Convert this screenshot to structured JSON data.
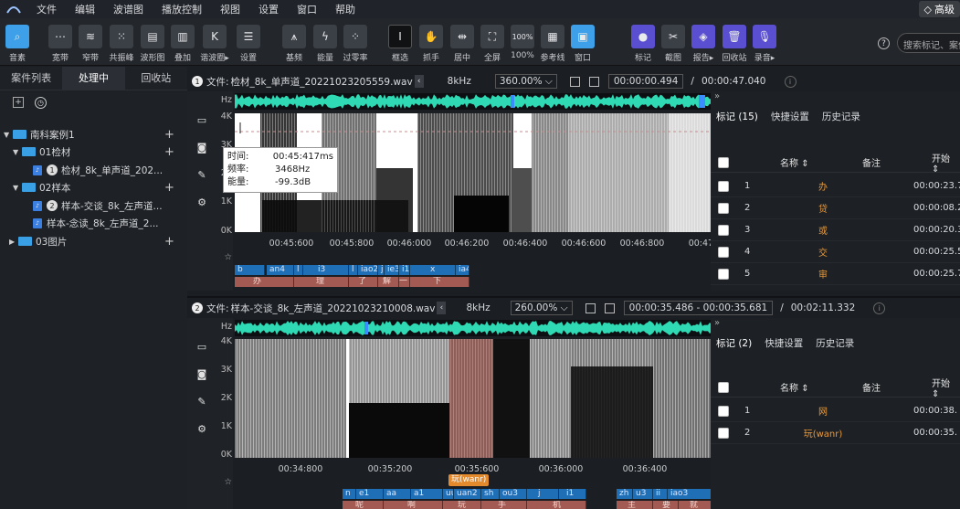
{
  "menubar": {
    "items": [
      "文件",
      "编辑",
      "波谱图",
      "播放控制",
      "视图",
      "设置",
      "窗口",
      "帮助"
    ],
    "premium": "高级"
  },
  "toolbar": {
    "buttons": [
      {
        "label": "音素",
        "icon": "magnifier-icon"
      },
      {
        "label": "宽带",
        "icon": "wideband-icon"
      },
      {
        "label": "窄带",
        "icon": "narrowband-icon"
      },
      {
        "label": "共振峰",
        "icon": "formant-icon"
      },
      {
        "label": "波形图",
        "icon": "waveform-icon"
      },
      {
        "label": "叠加",
        "icon": "overlay-icon"
      },
      {
        "label": "谐波圈▸",
        "icon": "harmonic-icon"
      },
      {
        "label": "设置",
        "icon": "settings-sliders-icon"
      },
      {
        "label": "基频",
        "icon": "pitch-icon"
      },
      {
        "label": "能量",
        "icon": "energy-icon"
      },
      {
        "label": "过零率",
        "icon": "zero-cross-icon"
      },
      {
        "label": "框选",
        "icon": "text-cursor-icon"
      },
      {
        "label": "抓手",
        "icon": "hand-icon"
      },
      {
        "label": "居中",
        "icon": "center-icon"
      },
      {
        "label": "全屏",
        "icon": "fullscreen-icon"
      },
      {
        "label": "100%",
        "icon": "zoom-100-icon",
        "text": "100%"
      },
      {
        "label": "参考线",
        "icon": "grid-icon"
      },
      {
        "label": "窗口",
        "icon": "window-icon"
      },
      {
        "label": "标记",
        "icon": "marker-pin-icon"
      },
      {
        "label": "截图",
        "icon": "scissors-icon"
      },
      {
        "label": "报告▸",
        "icon": "layers-icon"
      },
      {
        "label": "回收站",
        "icon": "trash-icon"
      },
      {
        "label": "录音▸",
        "icon": "microphone-icon"
      }
    ],
    "search_placeholder": "搜索标记、案件"
  },
  "left_panel": {
    "tabs": [
      "案件列表",
      "处理中",
      "回收站"
    ],
    "active_tab": 1,
    "tree": [
      {
        "label": "南科案例1",
        "level": 0,
        "type": "folder",
        "expanded": true
      },
      {
        "label": "01检材",
        "level": 1,
        "type": "folder",
        "expanded": true
      },
      {
        "label": "检材_8k_单声道_202...",
        "level": 2,
        "type": "file",
        "badge": "1"
      },
      {
        "label": "02样本",
        "level": 1,
        "type": "folder",
        "expanded": true
      },
      {
        "label": "样本-交谈_8k_左声道...",
        "level": 2,
        "type": "file",
        "badge": "2"
      },
      {
        "label": "样本-念读_8k_左声道_2...",
        "level": 2,
        "type": "file",
        "badge": ""
      },
      {
        "label": "03图片",
        "level": 1,
        "type": "folder",
        "expanded": false
      }
    ]
  },
  "panel1": {
    "badge": "1",
    "file_label": "文件:",
    "file_name": "检材_8k_单声道_20221023205559.wav",
    "sample_rate": "8kHz",
    "zoom": "360.00%",
    "time_current": "00:00:00.494",
    "time_sep": "/",
    "time_total": "00:00:47.040",
    "y_ticks": [
      "Hz",
      "4K",
      "3K",
      "2K",
      "1K",
      "0K"
    ],
    "x_ticks": [
      "00:45:600",
      "00:45:800",
      "00:46:000",
      "00:46:200",
      "00:46:400",
      "00:46:600",
      "00:46:800",
      "00:47:0"
    ],
    "phonemes": [
      "b",
      "an4",
      "l",
      "i3",
      "l",
      "iao2",
      "j",
      "ie3",
      "i1",
      "x",
      "ia4"
    ],
    "chars": [
      "办",
      "理",
      "了",
      "解",
      "一",
      "下"
    ],
    "tooltip": {
      "time_k": "时间:",
      "time_v": "00:45:417ms",
      "freq_k": "频率:",
      "freq_v": "3468Hz",
      "energy_k": "能量:",
      "energy_v": "-99.3dB"
    },
    "right": {
      "tabs": [
        "标记 (15)",
        "快捷设置",
        "历史记录"
      ],
      "headers": {
        "name": "名称",
        "note": "备注",
        "start": "开始"
      },
      "rows": [
        {
          "idx": "1",
          "name": "办",
          "start": "00:00:23.7"
        },
        {
          "idx": "2",
          "name": "贷",
          "start": "00:00:08.2"
        },
        {
          "idx": "3",
          "name": "或",
          "start": "00:00:20.3"
        },
        {
          "idx": "4",
          "name": "交",
          "start": "00:00:25.5"
        },
        {
          "idx": "5",
          "name": "审",
          "start": "00:00:25.7"
        }
      ]
    }
  },
  "panel2": {
    "badge": "2",
    "file_label": "文件:",
    "file_name": "样本-交谈_8k_左声道_20221023210008.wav",
    "sample_rate": "8kHz",
    "zoom": "260.00%",
    "time_current": "00:00:35.486 - 00:00:35.681",
    "time_sep": "/",
    "time_total": "00:02:11.332",
    "y_ticks": [
      "Hz",
      "4K",
      "3K",
      "2K",
      "1K",
      "0K"
    ],
    "x_ticks": [
      "00:34:800",
      "00:35:200",
      "00:35:600",
      "00:36:000",
      "00:36:400"
    ],
    "selection_tag": "玩(wanr)",
    "phonemes": [
      "n",
      "e1",
      "aa",
      "a1",
      "uu",
      "uan2",
      "sh",
      "ou3",
      "j",
      "i1",
      "zh",
      "u3",
      "ii",
      "iao3"
    ],
    "chars": [
      "呢",
      "啊",
      "玩",
      "手",
      "机",
      "主",
      "要",
      "就"
    ],
    "right": {
      "tabs": [
        "标记 (2)",
        "快捷设置",
        "历史记录"
      ],
      "headers": {
        "name": "名称",
        "note": "备注",
        "start": "开始"
      },
      "rows": [
        {
          "idx": "1",
          "name": "网",
          "start": "00:00:38."
        },
        {
          "idx": "2",
          "name": "玩(wanr)",
          "start": "00:00:35."
        }
      ]
    }
  }
}
